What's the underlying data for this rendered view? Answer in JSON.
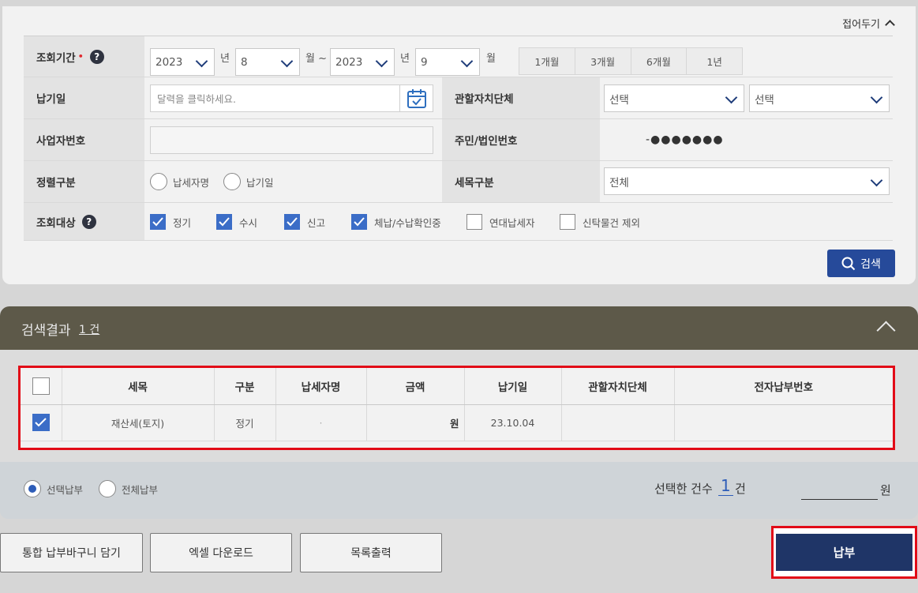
{
  "search": {
    "fold_label": "접어두기",
    "period": {
      "label": "조회기간",
      "required_mark": "•",
      "help": "?",
      "from_year": "2023",
      "from_month": "8",
      "to_year": "2023",
      "to_month": "9",
      "year_unit": "년",
      "month_unit_tilde": "월 ~",
      "month_unit": "월",
      "quick": [
        "1개월",
        "3개월",
        "6개월",
        "1년"
      ]
    },
    "due_date": {
      "label": "납기일",
      "placeholder": "달력을 클릭하세요."
    },
    "jurisdiction": {
      "label": "관할자치단체",
      "select1": "선택",
      "select2": "선택"
    },
    "business_no": {
      "label": "사업자번호",
      "value": ""
    },
    "resident_no": {
      "label": "주민/법인번호",
      "masked": "-●●●●●●●"
    },
    "sort": {
      "label": "정렬구분",
      "options": [
        "납세자명",
        "납기일"
      ]
    },
    "tax_type": {
      "label": "세목구분",
      "value": "전체"
    },
    "target": {
      "label": "조회대상",
      "help": "?",
      "options": [
        {
          "label": "정기",
          "checked": true
        },
        {
          "label": "수시",
          "checked": true
        },
        {
          "label": "신고",
          "checked": true
        },
        {
          "label": "체납/수납확인중",
          "checked": true
        },
        {
          "label": "연대납세자",
          "checked": false
        },
        {
          "label": "신탁물건 제외",
          "checked": false
        }
      ]
    },
    "search_button": "검색"
  },
  "results": {
    "title": "검색결과",
    "count": "1 건",
    "columns": [
      "세목",
      "구분",
      "납세자명",
      "금액",
      "납기일",
      "관할자치단체",
      "전자납부번호"
    ],
    "rows": [
      {
        "checked": true,
        "tax_item": "재산세(토지)",
        "type": "정기",
        "taxpayer": "·",
        "amount": "원",
        "due_date": "23.10.04",
        "jurisdiction": "",
        "epay_no": ""
      }
    ]
  },
  "payment": {
    "options": [
      {
        "label": "선택납부",
        "selected": true
      },
      {
        "label": "전체납부",
        "selected": false
      }
    ],
    "selected_count_label": "선택한 건수",
    "selected_count": "1",
    "count_unit": "건",
    "amount_unit": "원"
  },
  "buttons": {
    "cart": "통합 납부바구니 담기",
    "excel": "엑셀 다운로드",
    "print": "목록출력",
    "pay": "납부"
  },
  "colors": {
    "accent": "#264a9a",
    "pay_button": "#1f3567",
    "result_header": "#5d5949",
    "highlight": "#e20b17"
  }
}
